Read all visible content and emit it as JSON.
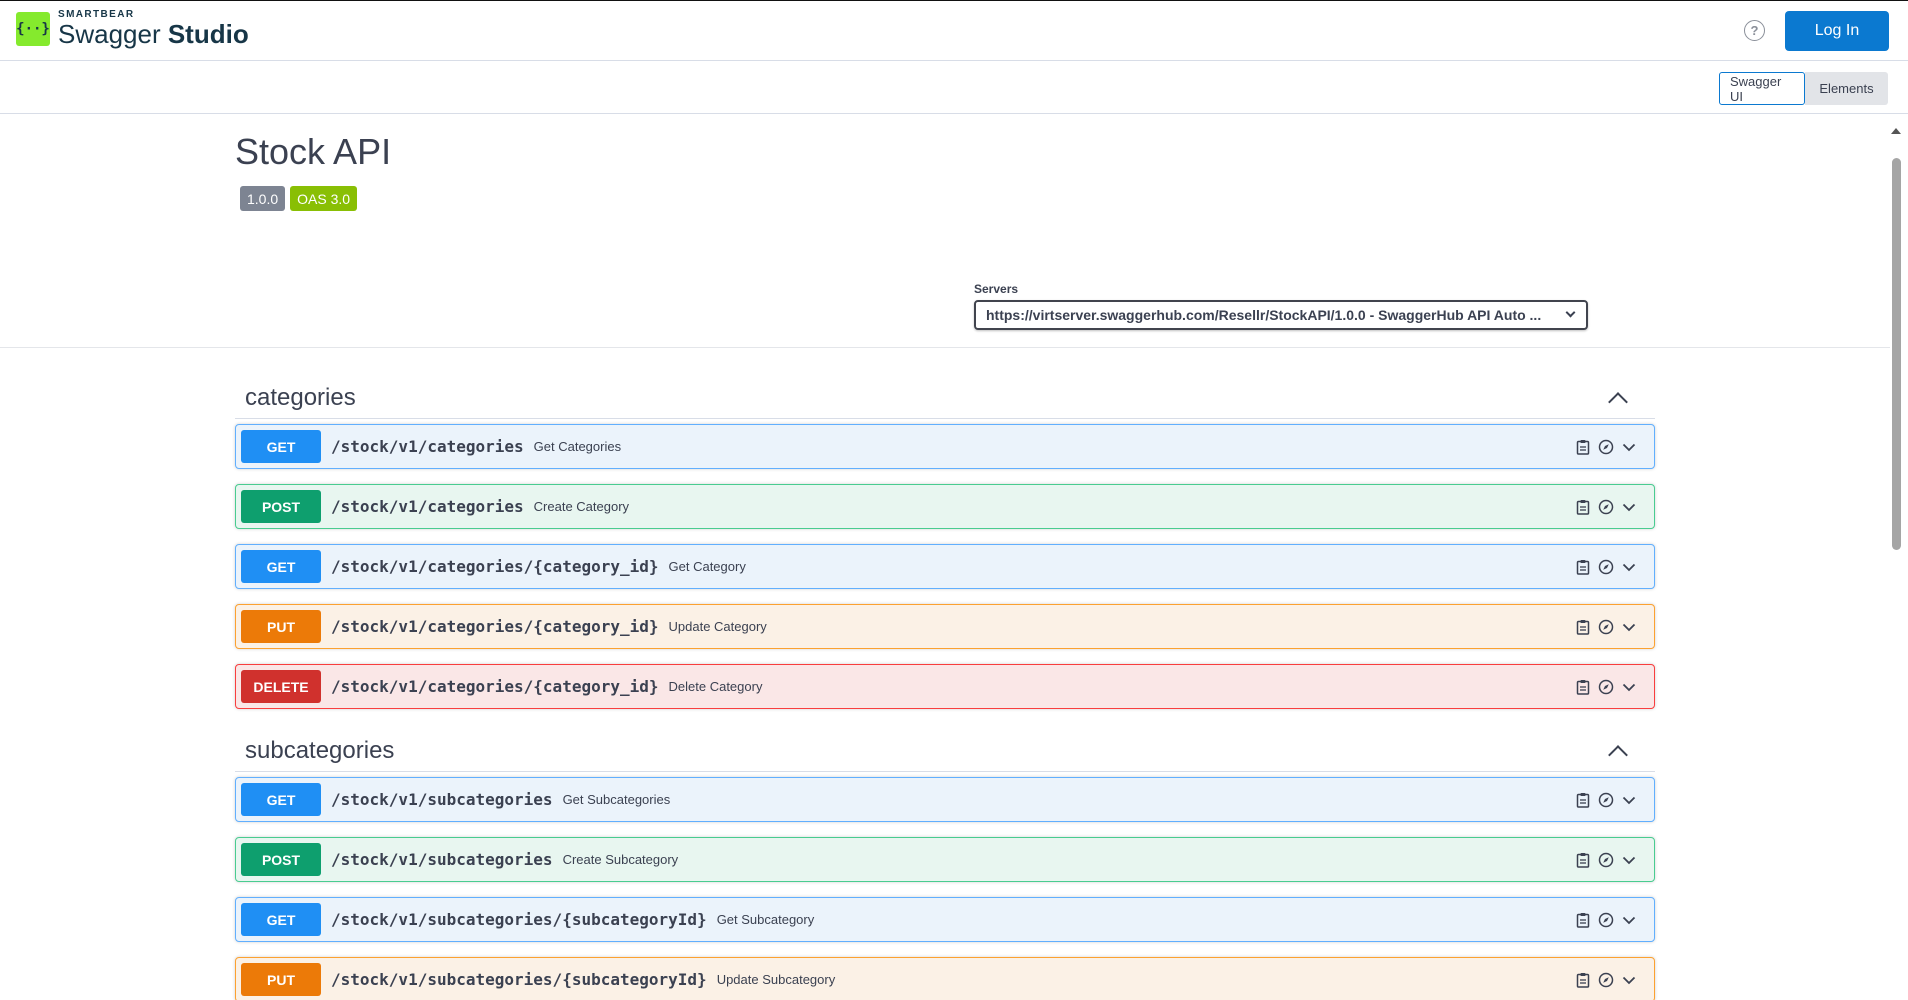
{
  "header": {
    "brand": "SMARTBEAR",
    "product_light": "Swagger ",
    "product_bold": "Studio",
    "logo_glyph": "{··}",
    "help_glyph": "?",
    "login_label": "Log In"
  },
  "view_toggle": {
    "swagger_ui": "Swagger UI",
    "elements": "Elements"
  },
  "info": {
    "title": "Stock API",
    "version": "1.0.0",
    "oas": "OAS 3.0"
  },
  "servers": {
    "label": "Servers",
    "selected": "https://virtserver.swaggerhub.com/Resellr/StockAPI/1.0.0 - SwaggerHub API Auto ..."
  },
  "tags": [
    {
      "name": "categories",
      "operations": [
        {
          "method": "GET",
          "path": "/stock/v1/categories",
          "summary": "Get Categories"
        },
        {
          "method": "POST",
          "path": "/stock/v1/categories",
          "summary": "Create Category"
        },
        {
          "method": "GET",
          "path": "/stock/v1/categories/{category_id}",
          "summary": "Get Category"
        },
        {
          "method": "PUT",
          "path": "/stock/v1/categories/{category_id}",
          "summary": "Update Category"
        },
        {
          "method": "DELETE",
          "path": "/stock/v1/categories/{category_id}",
          "summary": "Delete Category"
        }
      ]
    },
    {
      "name": "subcategories",
      "operations": [
        {
          "method": "GET",
          "path": "/stock/v1/subcategories",
          "summary": "Get Subcategories"
        },
        {
          "method": "POST",
          "path": "/stock/v1/subcategories",
          "summary": "Create Subcategory"
        },
        {
          "method": "GET",
          "path": "/stock/v1/subcategories/{subcategoryId}",
          "summary": "Get Subcategory"
        },
        {
          "method": "PUT",
          "path": "/stock/v1/subcategories/{subcategoryId}",
          "summary": "Update Subcategory"
        }
      ]
    }
  ],
  "colors": {
    "get": "#1f8ff4",
    "post": "#0e9f6e",
    "put": "#ec7a08",
    "delete": "#d0312d",
    "login": "#0b79d0",
    "logo": "#85ea2d"
  }
}
